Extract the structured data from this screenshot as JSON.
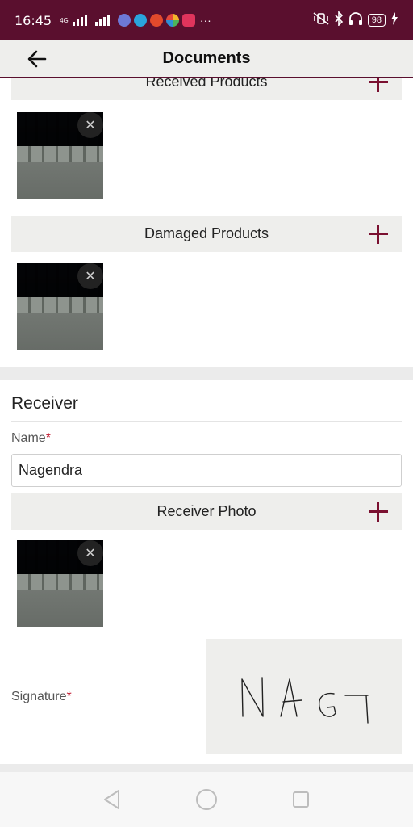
{
  "status_bar": {
    "time": "16:45",
    "network": "4G",
    "battery": "98",
    "more": "···",
    "colors": {
      "background": "#5a0f2e"
    }
  },
  "app_bar": {
    "title": "Documents",
    "back_icon": "arrow-left-icon"
  },
  "sections": {
    "received_products": {
      "label": "Received Products"
    },
    "damaged_products": {
      "label": "Damaged Products"
    }
  },
  "receiver": {
    "heading": "Receiver",
    "name_label": "Name",
    "name_value": "Nagendra",
    "photo_label": "Receiver Photo",
    "signature_label": "Signature",
    "required_marker": "*",
    "signature_text": "NAGI"
  },
  "accent_color": "#7a1030",
  "nav_bar": {
    "icons": [
      "back-triangle-icon",
      "home-circle-icon",
      "recents-square-icon"
    ]
  }
}
